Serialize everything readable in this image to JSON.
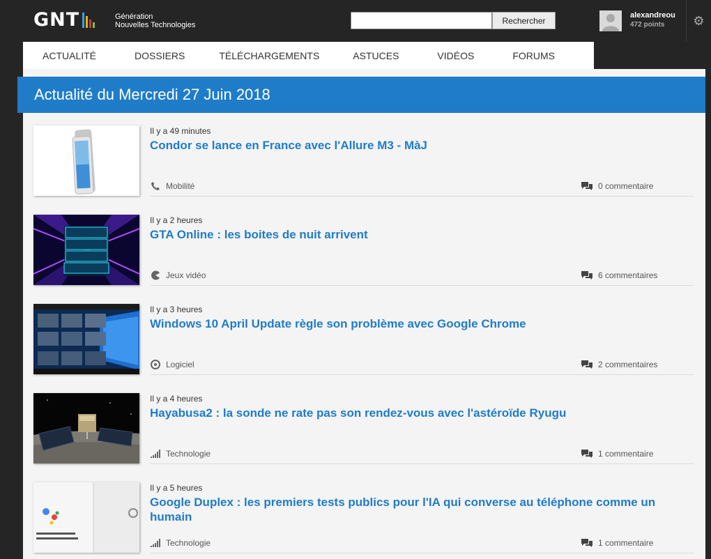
{
  "header": {
    "logo_text": "GNT",
    "logo_line1": "Génération",
    "logo_line2": "Nouvelles Technologies",
    "search_button": "Rechercher",
    "search_value": "",
    "user_name": "alexandreou",
    "user_points": "472 points",
    "settings_icon": "gear-icon",
    "logo_bar_colors": [
      "#3aa0e0",
      "#e8b400",
      "#d43a3a",
      "#7cc242"
    ]
  },
  "nav": {
    "items": [
      "ACTUALITÉ",
      "DOSSIERS",
      "TÉLÉCHARGEMENTS",
      "ASTUCES",
      "VIDÉOS",
      "FORUMS"
    ]
  },
  "banner": {
    "title": "Actualité du Mercredi 27 Juin 2018"
  },
  "colors": {
    "accent": "#1f7cc9",
    "header_bg": "#252525"
  },
  "articles": [
    {
      "time": "Il y a 49 minutes",
      "title": "Condor se lance en France avec l'Allure M3 - MàJ",
      "category": "Mobilité",
      "category_icon": "phone-icon",
      "comments": "0 commentaire"
    },
    {
      "time": "Il y a 2 heures",
      "title": "GTA Online : les boites de nuit arrivent",
      "category": "Jeux vidéo",
      "category_icon": "pacman-icon",
      "comments": "6 commentaires"
    },
    {
      "time": "Il y a 3 heures",
      "title": "Windows 10 April Update règle son problème avec Google Chrome",
      "category": "Logiciel",
      "category_icon": "disc-icon",
      "comments": "2 commentaires"
    },
    {
      "time": "Il y a 4 heures",
      "title": "Hayabusa2 : la sonde ne rate pas son rendez-vous avec l'astéroïde Ryugu",
      "category": "Technologie",
      "category_icon": "signal-bars-icon",
      "comments": "1 commentaire"
    },
    {
      "time": "Il y a 5 heures",
      "title": "Google Duplex : les premiers tests publics pour l'IA qui converse au téléphone comme un humain",
      "category": "Technologie",
      "category_icon": "signal-bars-icon",
      "comments": "1 commentaire"
    }
  ]
}
